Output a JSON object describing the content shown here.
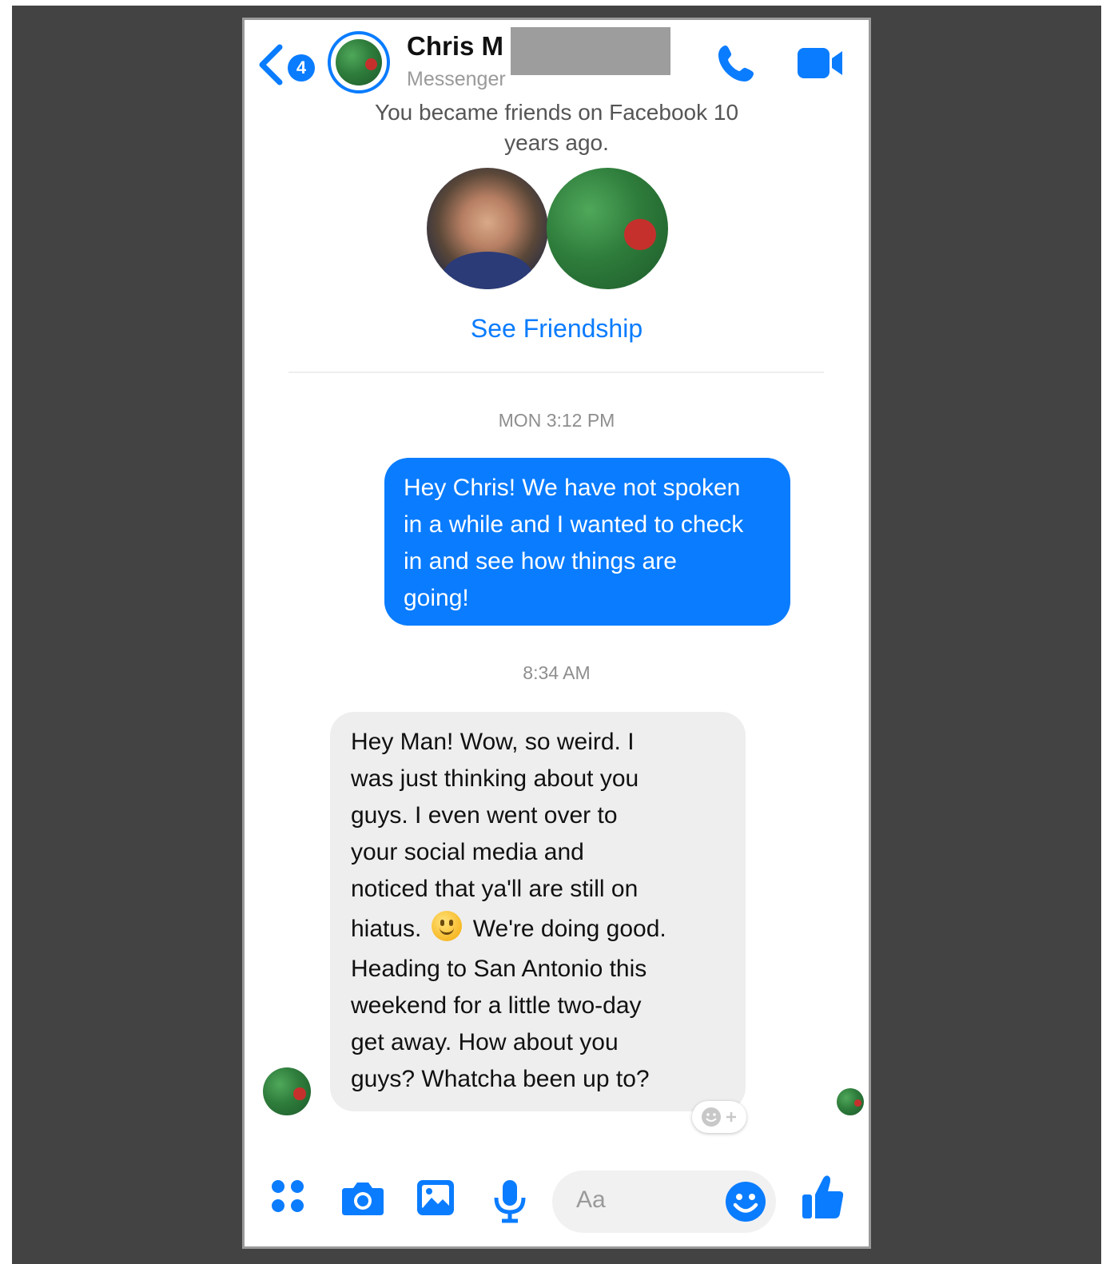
{
  "header": {
    "back_badge": "4",
    "contact_name": "Chris M",
    "contact_subtitle": "Messenger"
  },
  "intro": {
    "friends_note_line1": "You became friends on Facebook 10",
    "friends_note_line2": "years ago.",
    "see_friendship": "See Friendship"
  },
  "messages": [
    {
      "timestamp": "MON 3:12 PM",
      "direction": "outgoing",
      "lines": [
        "Hey Chris! We have not spoken",
        "in a while and I wanted to check",
        "in and see how things are",
        "going!"
      ]
    },
    {
      "timestamp": "8:34 AM",
      "direction": "incoming",
      "lines": [
        "Hey Man! Wow, so weird.  I",
        "was just thinking about you",
        "guys.  I even went over to",
        "your social media and",
        "noticed that ya'll are still on",
        "hiatus.",
        "We're doing good.",
        "Heading to San Antonio this",
        "weekend for a little two-day",
        "get away.  How about you",
        "guys?  Whatcha been up to?"
      ]
    }
  ],
  "composer": {
    "placeholder": "Aa",
    "icons": [
      "apps-icon",
      "camera-icon",
      "image-icon",
      "microphone-icon",
      "emoji-icon",
      "thumbs-up-icon"
    ]
  },
  "colors": {
    "accent": "#0a7cff",
    "incoming_bubble": "#eeeeef",
    "backdrop": "#434343"
  }
}
